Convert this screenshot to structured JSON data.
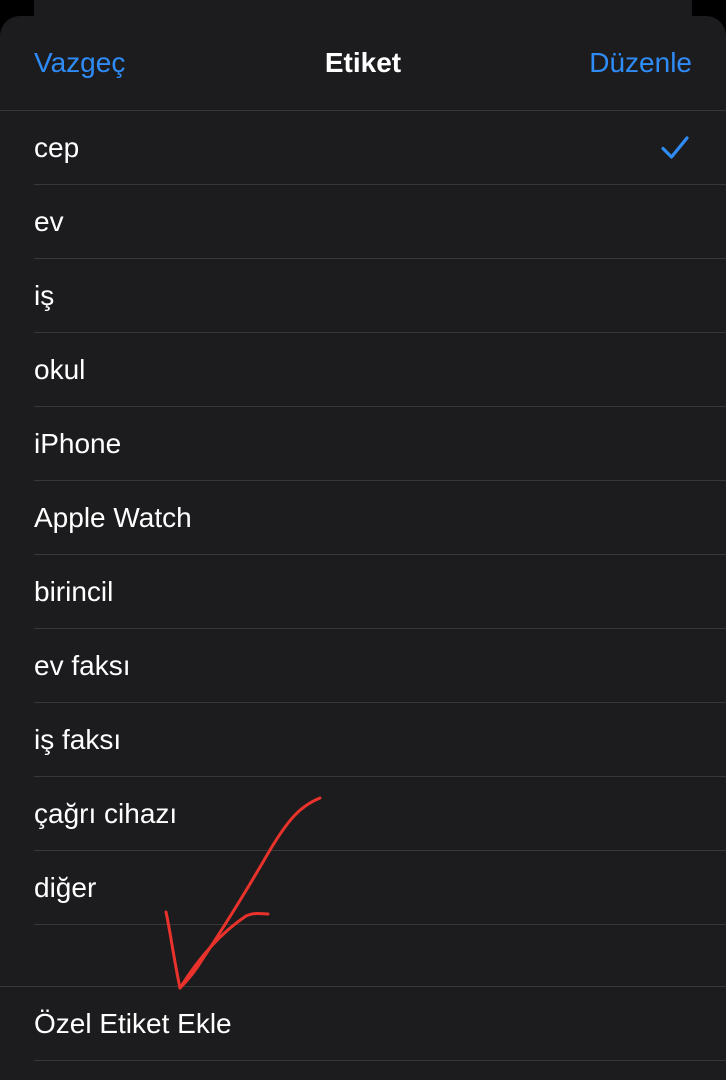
{
  "header": {
    "cancel_label": "Vazgeç",
    "title": "Etiket",
    "edit_label": "Düzenle"
  },
  "labels": [
    {
      "label": "cep",
      "selected": true
    },
    {
      "label": "ev",
      "selected": false
    },
    {
      "label": "iş",
      "selected": false
    },
    {
      "label": "okul",
      "selected": false
    },
    {
      "label": "iPhone",
      "selected": false
    },
    {
      "label": "Apple Watch",
      "selected": false
    },
    {
      "label": "birincil",
      "selected": false
    },
    {
      "label": "ev faksı",
      "selected": false
    },
    {
      "label": "iş faksı",
      "selected": false
    },
    {
      "label": "çağrı cihazı",
      "selected": false
    },
    {
      "label": "diğer",
      "selected": false
    }
  ],
  "custom": {
    "add_label": "Özel Etiket Ekle"
  },
  "icons": {
    "selected": "checkmark-icon",
    "annotation": "red-arrow-icon"
  },
  "colors": {
    "accent": "#2f8cf7",
    "background": "#1c1c1e",
    "separator": "#38383a",
    "annotation": "#e8322b"
  }
}
